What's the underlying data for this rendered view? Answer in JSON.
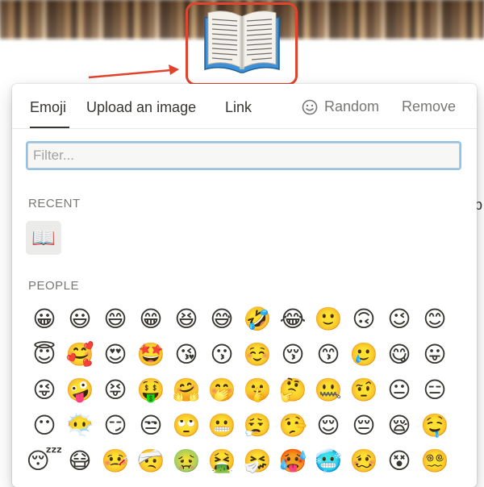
{
  "page": {
    "icon_glyph": "📖"
  },
  "picker": {
    "tabs": {
      "emoji": "Emoji",
      "upload": "Upload an image",
      "link": "Link",
      "random": "Random",
      "remove": "Remove"
    },
    "filter": {
      "placeholder": "Filter...",
      "value": ""
    },
    "recent": {
      "title": "RECENT",
      "items": [
        "📖"
      ]
    },
    "people": {
      "title": "PEOPLE",
      "emojis": [
        "😀",
        "😃",
        "😄",
        "😁",
        "😆",
        "😅",
        "🤣",
        "😂",
        "🙂",
        "🙃",
        "😉",
        "😊",
        "😇",
        "🥰",
        "😍",
        "🤩",
        "😘",
        "😗",
        "☺️",
        "😚",
        "😙",
        "🥲",
        "😋",
        "😛",
        "😜",
        "🤪",
        "😝",
        "🤑",
        "🤗",
        "🤭",
        "🤫",
        "🤔",
        "🤐",
        "🤨",
        "😐",
        "😑",
        "😶",
        "😶‍🌫️",
        "😏",
        "😒",
        "🙄",
        "😬",
        "😮‍💨",
        "🤥",
        "😌",
        "😔",
        "😪",
        "🤤",
        "😴",
        "😷",
        "🤒",
        "🤕",
        "🤢",
        "🤮",
        "🤧",
        "🥵",
        "🥶",
        "🥴",
        "😵",
        "😵‍💫"
      ]
    }
  },
  "background": {
    "edge_text": "p"
  },
  "colors": {
    "highlight": "#e0442c",
    "focus_ring": "#8cc4ec",
    "text": "#37352f",
    "muted": "#787774"
  }
}
